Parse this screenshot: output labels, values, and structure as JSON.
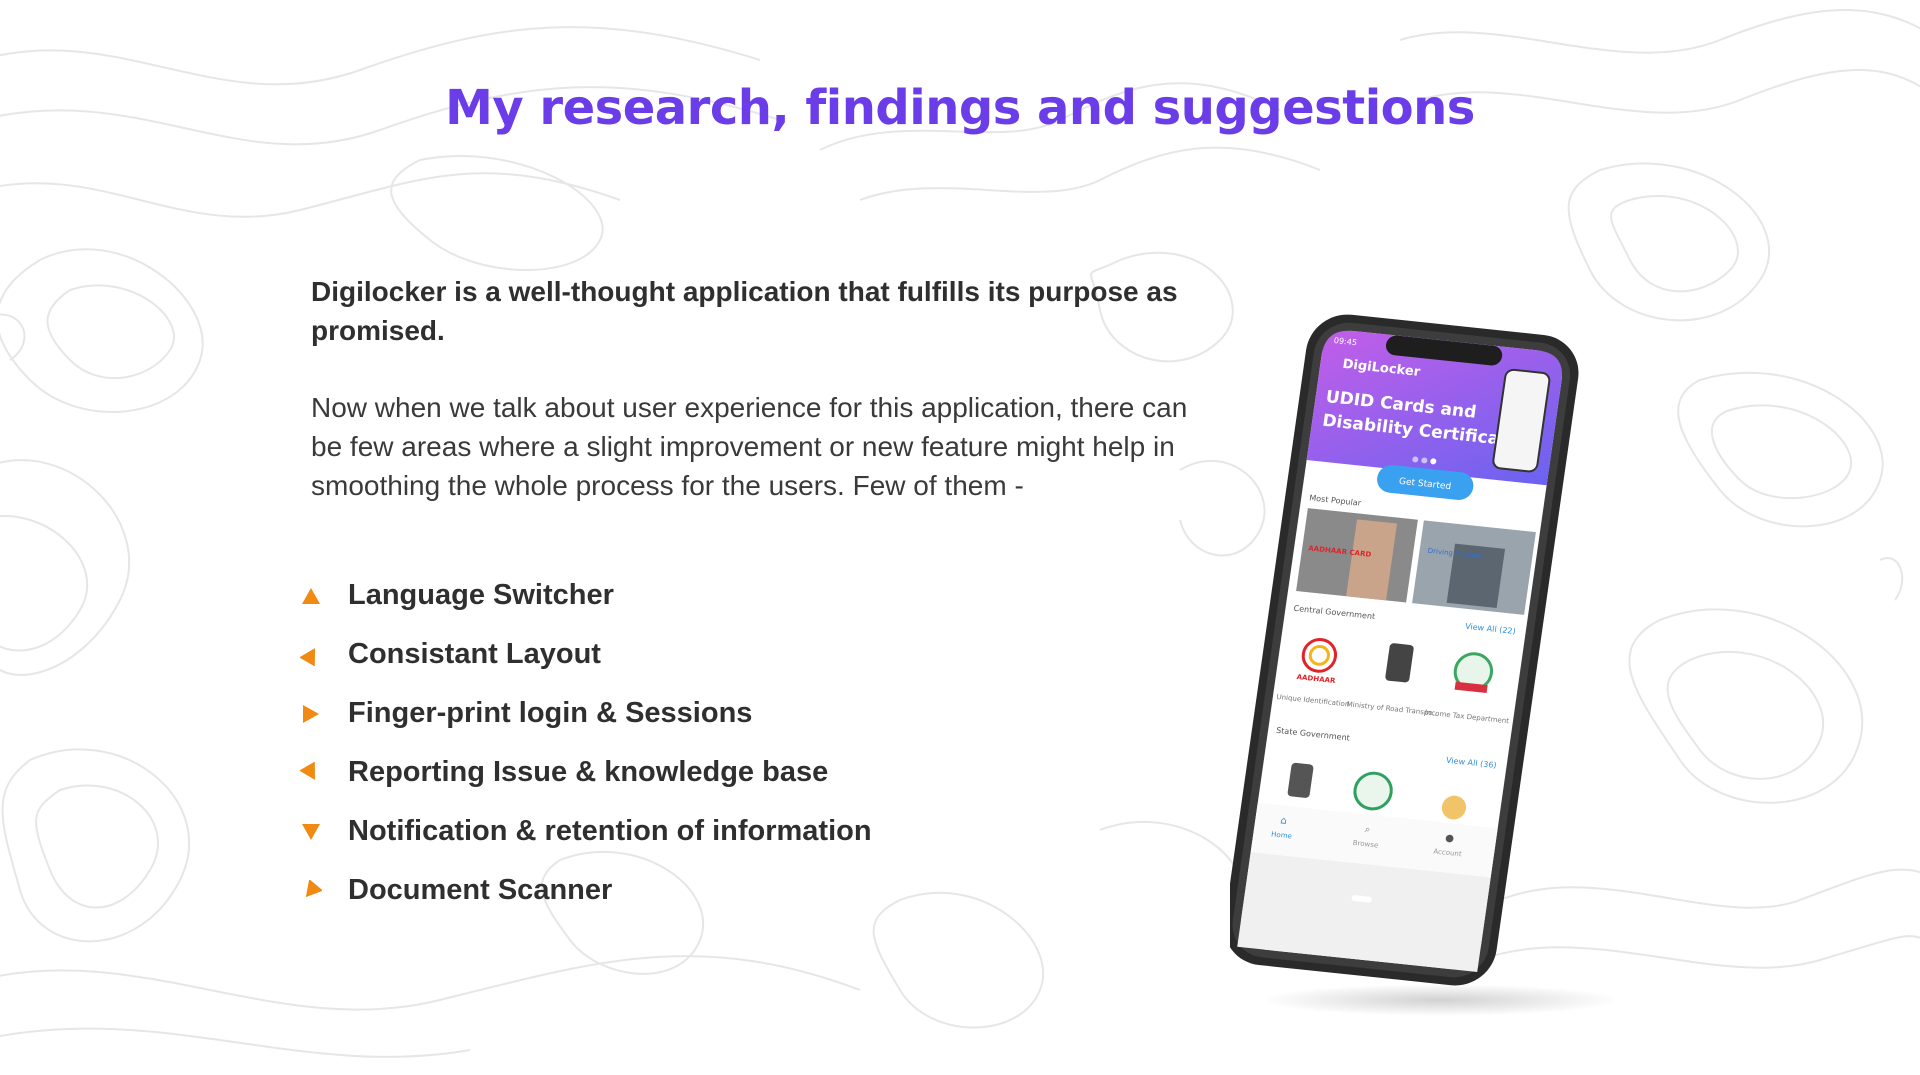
{
  "title": "My research, findings and suggestions",
  "intro_bold": "Digilocker is a well-thought application that fulfills its purpose as promised.",
  "intro_body": "Now when we talk about user experience for this application, there can be few areas where a slight improvement or new feature might help in smoothing the whole process for the users. Few of them -",
  "accent_color": "#6a3de8",
  "bullet_color": "#f08a12",
  "bullets": [
    {
      "label": "Language Switcher",
      "icon": "triangle-up-icon"
    },
    {
      "label": "Consistant Layout",
      "icon": "triangle-upright-icon"
    },
    {
      "label": "Finger-print login & Sessions",
      "icon": "triangle-right-icon"
    },
    {
      "label": "Reporting Issue & knowledge base",
      "icon": "triangle-downright-icon"
    },
    {
      "label": "Notification & retention of information",
      "icon": "triangle-down-icon"
    },
    {
      "label": "Document Scanner",
      "icon": "triangle-downleft-icon"
    }
  ],
  "phone": {
    "status_time": "09:45",
    "app_name": "DigiLocker",
    "banner_text": "UDID Cards and Disability Certificates",
    "cta": "Get Started",
    "section_popular": "Most Popular",
    "popular_tags": [
      "AADHAAR CARD",
      "Driving Licence"
    ],
    "section_central": "Central Government",
    "central_view_all": "View All (22)",
    "central_items": [
      "Unique Identification",
      "Ministry of Road Transpo...",
      "Income Tax Department"
    ],
    "aadhaar_logo_text": "AADHAAR",
    "section_state": "State Government",
    "state_view_all": "View All (36)",
    "nav": [
      "Home",
      "Browse",
      "Account"
    ]
  }
}
